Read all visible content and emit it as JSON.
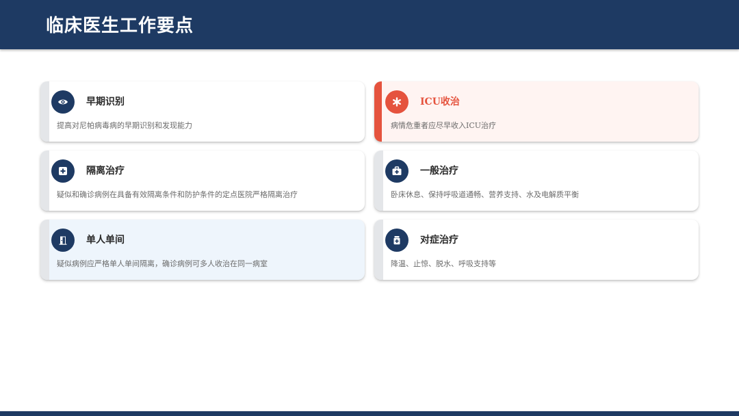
{
  "header": {
    "title": "临床医生工作要点"
  },
  "cards": [
    {
      "title": "早期识别",
      "description": "提高对尼帕病毒病的早期识别和发现能力",
      "icon": "eye-icon"
    },
    {
      "title": "ICU收治",
      "description": "病情危重者应尽早收入ICU治疗",
      "icon": "asterisk-icon"
    },
    {
      "title": "隔离治疗",
      "description": "疑似和确诊病例在具备有效隔离条件和防护条件的定点医院严格隔离治疗",
      "icon": "medical-plus-icon"
    },
    {
      "title": "一般治疗",
      "description": "卧床休息、保持呼吸道通畅、营养支持、水及电解质平衡",
      "icon": "first-aid-kit-icon"
    },
    {
      "title": "单人单间",
      "description": "疑似病例应严格单人单间隔离，确诊病例可多人收治在同一病室",
      "icon": "door-icon"
    },
    {
      "title": "对症治疗",
      "description": "降温、止惊、脱水、呼吸支持等",
      "icon": "medicine-bottle-icon"
    }
  ],
  "colors": {
    "primary": "#1e3a63",
    "alert": "#e5533e",
    "alert_background": "#fff4f2",
    "tint_background": "#eef5fc"
  }
}
